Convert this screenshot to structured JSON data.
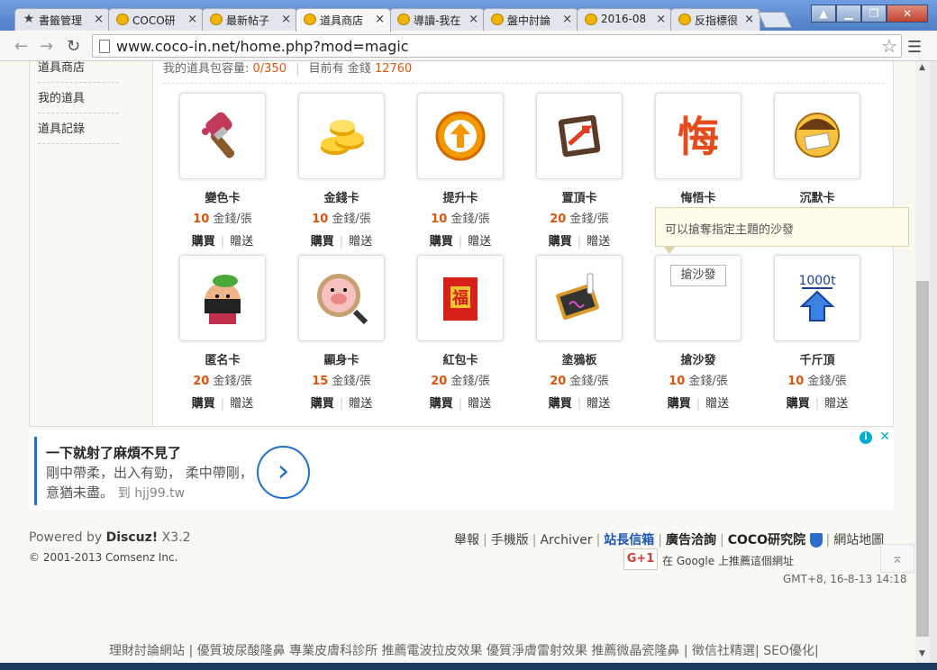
{
  "browser": {
    "tabs": [
      {
        "label": "書籤管理",
        "icon": "star-icon"
      },
      {
        "label": "COCO研",
        "icon": "coco-icon"
      },
      {
        "label": "最新帖子",
        "icon": "coco-icon"
      },
      {
        "label": "道具商店",
        "icon": "coco-icon",
        "active": true
      },
      {
        "label": "導讀-我在",
        "icon": "coco-icon"
      },
      {
        "label": "盤中討論",
        "icon": "coco-icon"
      },
      {
        "label": "2016-08",
        "icon": "coco-icon"
      },
      {
        "label": "反指標很",
        "icon": "coco-icon"
      }
    ],
    "close_glyph": "×",
    "url": "www.coco-in.net/home.php?mod=magic"
  },
  "sidebar": {
    "items": [
      "道具商店",
      "我的道具",
      "道具記錄"
    ]
  },
  "bag": {
    "prefix": "我的道具包容量:",
    "capacity": "0/350",
    "sep": "|",
    "money_prefix": "目前有 金錢",
    "money": "12760"
  },
  "items": [
    {
      "name": "變色卡",
      "price": "10",
      "unit": "金錢/張",
      "buy": "購買",
      "gift": "贈送",
      "icon": "paint-brush-icon"
    },
    {
      "name": "金錢卡",
      "price": "10",
      "unit": "金錢/張",
      "buy": "購買",
      "gift": "贈送",
      "icon": "gold-coins-icon"
    },
    {
      "name": "提升卡",
      "price": "10",
      "unit": "金錢/張",
      "buy": "購買",
      "gift": "贈送",
      "icon": "up-arrow-icon"
    },
    {
      "name": "置頂卡",
      "price": "20",
      "unit": "金錢/張",
      "buy": "購買",
      "gift": "贈送",
      "icon": "pin-top-icon"
    },
    {
      "name": "悔悟卡",
      "price": "",
      "unit": "",
      "buy": "",
      "gift": "",
      "icon": "regret-char-icon",
      "char": "悔"
    },
    {
      "name": "沉默卡",
      "price": "",
      "unit": "",
      "buy": "",
      "gift": "",
      "icon": "silence-face-icon"
    },
    {
      "name": "匿名卡",
      "price": "20",
      "unit": "金錢/張",
      "buy": "購買",
      "gift": "贈送",
      "icon": "ninja-icon"
    },
    {
      "name": "顯身卡",
      "price": "15",
      "unit": "金錢/張",
      "buy": "購買",
      "gift": "贈送",
      "icon": "magnifier-pig-icon"
    },
    {
      "name": "紅包卡",
      "price": "20",
      "unit": "金錢/張",
      "buy": "購買",
      "gift": "贈送",
      "icon": "red-envelope-icon",
      "char": "福"
    },
    {
      "name": "塗鴉板",
      "price": "20",
      "unit": "金錢/張",
      "buy": "購買",
      "gift": "贈送",
      "icon": "chalkboard-icon"
    },
    {
      "name": "搶沙發",
      "price": "10",
      "unit": "金錢/張",
      "buy": "購買",
      "gift": "贈送",
      "icon": "broken-image-icon",
      "alt": "搶沙發"
    },
    {
      "name": "千斤頂",
      "price": "10",
      "unit": "金錢/張",
      "buy": "購買",
      "gift": "贈送",
      "icon": "jack-1000t-icon",
      "char": "1000t"
    }
  ],
  "tooltip": "可以搶奪指定主題的沙發",
  "ad": {
    "headline": "一下就射了麻煩不見了",
    "body": "剛中帶柔，出入有勁， 柔中帶剛，意猶未盡。",
    "link": "到 hjj99.tw",
    "go": "›"
  },
  "footer": {
    "powered_prefix": "Powered by",
    "powered_brand": "Discuz!",
    "powered_version": "X3.2",
    "copyright": "© 2001-2013 Comsenz Inc.",
    "links": [
      "舉報",
      "手機版",
      "Archiver",
      "站長信箱",
      "廣告洽詢",
      "COCO研究院",
      "網站地圖"
    ],
    "gplus": "G+1",
    "gplus_text": "在 Google 上推薦這個網址",
    "time": "GMT+8, 16-8-13 14:18",
    "bottom_links": "理財討論網站 | 優質玻尿酸隆鼻 專業皮膚科診所 推薦電波拉皮效果 優質淨膚雷射效果 推薦微晶瓷隆鼻 | 徵信社精選| SEO優化|"
  },
  "colors": {
    "accent_price": "#e0540c",
    "link_blue": "#1a56b7",
    "page_bg": "#faf8f2"
  }
}
